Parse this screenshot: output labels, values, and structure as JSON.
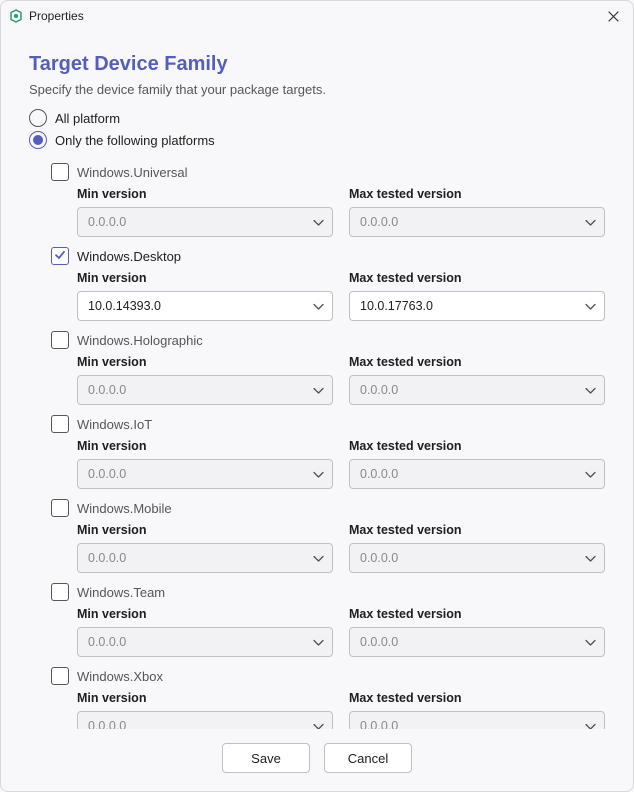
{
  "window": {
    "title": "Properties"
  },
  "page": {
    "heading": "Target Device Family",
    "subtitle": "Specify the device family that your package targets."
  },
  "scope": {
    "all_label": "All platform",
    "only_label": "Only the following platforms",
    "selected": "only"
  },
  "labels": {
    "min_version": "Min version",
    "max_tested": "Max tested version"
  },
  "placeholder_version": "0.0.0.0",
  "families": [
    {
      "id": "universal",
      "name": "Windows.Universal",
      "checked": false,
      "min": "",
      "max": ""
    },
    {
      "id": "desktop",
      "name": "Windows.Desktop",
      "checked": true,
      "min": "10.0.14393.0",
      "max": "10.0.17763.0"
    },
    {
      "id": "holographic",
      "name": "Windows.Holographic",
      "checked": false,
      "min": "",
      "max": ""
    },
    {
      "id": "iot",
      "name": "Windows.IoT",
      "checked": false,
      "min": "",
      "max": ""
    },
    {
      "id": "mobile",
      "name": "Windows.Mobile",
      "checked": false,
      "min": "",
      "max": ""
    },
    {
      "id": "team",
      "name": "Windows.Team",
      "checked": false,
      "min": "",
      "max": ""
    },
    {
      "id": "xbox",
      "name": "Windows.Xbox",
      "checked": false,
      "min": "",
      "max": ""
    }
  ],
  "buttons": {
    "save": "Save",
    "cancel": "Cancel"
  }
}
